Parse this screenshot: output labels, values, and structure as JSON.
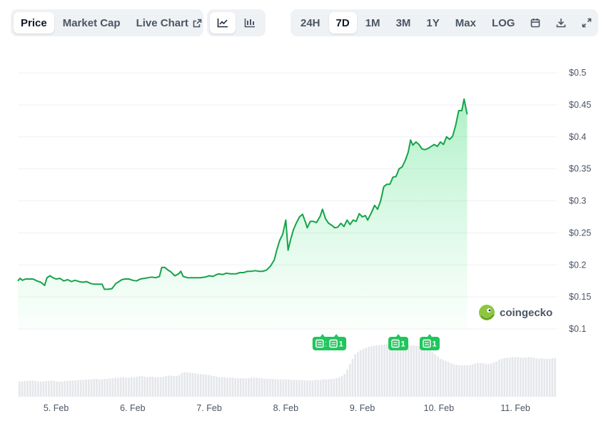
{
  "tabs_left": [
    {
      "label": "Price",
      "active": true
    },
    {
      "label": "Market Cap",
      "active": false
    },
    {
      "label": "Live Chart",
      "active": false,
      "icon": "external-link-icon"
    }
  ],
  "tabs_chart_type": [
    {
      "icon": "line-chart-icon",
      "active": true
    },
    {
      "icon": "candlestick-chart-icon",
      "active": false
    }
  ],
  "tabs_range": [
    {
      "label": "24H",
      "active": false
    },
    {
      "label": "7D",
      "active": true
    },
    {
      "label": "1M",
      "active": false
    },
    {
      "label": "3M",
      "active": false
    },
    {
      "label": "1Y",
      "active": false
    },
    {
      "label": "Max",
      "active": false
    },
    {
      "label": "LOG",
      "active": false
    }
  ],
  "tools": [
    {
      "icon": "calendar-icon"
    },
    {
      "icon": "download-icon"
    },
    {
      "icon": "fullscreen-icon"
    }
  ],
  "watermark": {
    "text": "coingecko"
  },
  "colors": {
    "line": "#16a34a",
    "badge": "#22c55e",
    "volume": "#e5e7eb",
    "accent_fill": "#bbf7d0"
  },
  "chart_data": {
    "type": "area",
    "y_axis": {
      "ticks": [
        "$0.5",
        "$0.45",
        "$0.4",
        "$0.35",
        "$0.3",
        "$0.25",
        "$0.2",
        "$0.15",
        "$0.1"
      ],
      "values": [
        0.5,
        0.45,
        0.4,
        0.35,
        0.3,
        0.25,
        0.2,
        0.15,
        0.1
      ],
      "ylim": [
        0.1,
        0.5
      ]
    },
    "x_axis": {
      "ticks": [
        "5. Feb",
        "6. Feb",
        "7. Feb",
        "8. Feb",
        "9. Feb",
        "10. Feb",
        "11. Feb"
      ],
      "positions": [
        1,
        2,
        3,
        4,
        5,
        6,
        7
      ],
      "xlim": [
        0.5,
        7.54
      ]
    },
    "price_series": [
      [
        0.5,
        0.175
      ],
      [
        0.53,
        0.179
      ],
      [
        0.56,
        0.176
      ],
      [
        0.6,
        0.178
      ],
      [
        0.65,
        0.178
      ],
      [
        0.7,
        0.178
      ],
      [
        0.75,
        0.175
      ],
      [
        0.8,
        0.173
      ],
      [
        0.85,
        0.168
      ],
      [
        0.88,
        0.18
      ],
      [
        0.92,
        0.183
      ],
      [
        0.96,
        0.18
      ],
      [
        1.0,
        0.178
      ],
      [
        1.05,
        0.179
      ],
      [
        1.1,
        0.175
      ],
      [
        1.15,
        0.177
      ],
      [
        1.2,
        0.174
      ],
      [
        1.25,
        0.176
      ],
      [
        1.3,
        0.174
      ],
      [
        1.35,
        0.173
      ],
      [
        1.4,
        0.174
      ],
      [
        1.45,
        0.171
      ],
      [
        1.5,
        0.17
      ],
      [
        1.55,
        0.17
      ],
      [
        1.6,
        0.17
      ],
      [
        1.63,
        0.162
      ],
      [
        1.68,
        0.162
      ],
      [
        1.73,
        0.163
      ],
      [
        1.78,
        0.171
      ],
      [
        1.82,
        0.174
      ],
      [
        1.86,
        0.177
      ],
      [
        1.9,
        0.178
      ],
      [
        1.95,
        0.178
      ],
      [
        2.0,
        0.176
      ],
      [
        2.05,
        0.175
      ],
      [
        2.1,
        0.178
      ],
      [
        2.15,
        0.179
      ],
      [
        2.2,
        0.18
      ],
      [
        2.25,
        0.181
      ],
      [
        2.3,
        0.18
      ],
      [
        2.35,
        0.182
      ],
      [
        2.38,
        0.196
      ],
      [
        2.42,
        0.196
      ],
      [
        2.46,
        0.192
      ],
      [
        2.5,
        0.189
      ],
      [
        2.55,
        0.183
      ],
      [
        2.6,
        0.186
      ],
      [
        2.63,
        0.19
      ],
      [
        2.66,
        0.182
      ],
      [
        2.72,
        0.18
      ],
      [
        2.8,
        0.18
      ],
      [
        2.88,
        0.18
      ],
      [
        2.95,
        0.181
      ],
      [
        3.0,
        0.183
      ],
      [
        3.05,
        0.182
      ],
      [
        3.08,
        0.184
      ],
      [
        3.12,
        0.186
      ],
      [
        3.18,
        0.185
      ],
      [
        3.22,
        0.187
      ],
      [
        3.28,
        0.186
      ],
      [
        3.35,
        0.186
      ],
      [
        3.4,
        0.188
      ],
      [
        3.45,
        0.188
      ],
      [
        3.5,
        0.19
      ],
      [
        3.55,
        0.19
      ],
      [
        3.6,
        0.191
      ],
      [
        3.65,
        0.19
      ],
      [
        3.7,
        0.19
      ],
      [
        3.75,
        0.192
      ],
      [
        3.8,
        0.198
      ],
      [
        3.85,
        0.208
      ],
      [
        3.88,
        0.222
      ],
      [
        3.92,
        0.238
      ],
      [
        3.96,
        0.248
      ],
      [
        4.0,
        0.27
      ],
      [
        4.03,
        0.223
      ],
      [
        4.06,
        0.238
      ],
      [
        4.1,
        0.255
      ],
      [
        4.14,
        0.266
      ],
      [
        4.18,
        0.275
      ],
      [
        4.22,
        0.279
      ],
      [
        4.26,
        0.266
      ],
      [
        4.28,
        0.258
      ],
      [
        4.32,
        0.268
      ],
      [
        4.36,
        0.268
      ],
      [
        4.4,
        0.266
      ],
      [
        4.45,
        0.276
      ],
      [
        4.48,
        0.287
      ],
      [
        4.52,
        0.272
      ],
      [
        4.56,
        0.265
      ],
      [
        4.6,
        0.262
      ],
      [
        4.64,
        0.258
      ],
      [
        4.68,
        0.259
      ],
      [
        4.72,
        0.265
      ],
      [
        4.76,
        0.26
      ],
      [
        4.8,
        0.27
      ],
      [
        4.84,
        0.263
      ],
      [
        4.88,
        0.27
      ],
      [
        4.92,
        0.268
      ],
      [
        4.96,
        0.28
      ],
      [
        5.0,
        0.275
      ],
      [
        5.04,
        0.277
      ],
      [
        5.07,
        0.27
      ],
      [
        5.12,
        0.282
      ],
      [
        5.16,
        0.293
      ],
      [
        5.2,
        0.287
      ],
      [
        5.24,
        0.3
      ],
      [
        5.28,
        0.322
      ],
      [
        5.32,
        0.326
      ],
      [
        5.36,
        0.326
      ],
      [
        5.4,
        0.337
      ],
      [
        5.44,
        0.338
      ],
      [
        5.48,
        0.35
      ],
      [
        5.52,
        0.353
      ],
      [
        5.56,
        0.363
      ],
      [
        5.6,
        0.376
      ],
      [
        5.63,
        0.395
      ],
      [
        5.66,
        0.387
      ],
      [
        5.7,
        0.392
      ],
      [
        5.74,
        0.388
      ],
      [
        5.78,
        0.381
      ],
      [
        5.82,
        0.38
      ],
      [
        5.86,
        0.382
      ],
      [
        5.9,
        0.385
      ],
      [
        5.94,
        0.388
      ],
      [
        5.98,
        0.385
      ],
      [
        6.02,
        0.392
      ],
      [
        6.06,
        0.388
      ],
      [
        6.1,
        0.4
      ],
      [
        6.14,
        0.396
      ],
      [
        6.18,
        0.401
      ],
      [
        6.22,
        0.418
      ],
      [
        6.26,
        0.441
      ],
      [
        6.3,
        0.441
      ],
      [
        6.33,
        0.459
      ],
      [
        6.37,
        0.435
      ]
    ],
    "volume_series": [
      0.28,
      0.28,
      0.29,
      0.29,
      0.3,
      0.3,
      0.29,
      0.28,
      0.28,
      0.28,
      0.29,
      0.29,
      0.3,
      0.29,
      0.28,
      0.28,
      0.28,
      0.29,
      0.29,
      0.3,
      0.3,
      0.3,
      0.31,
      0.31,
      0.31,
      0.32,
      0.32,
      0.32,
      0.33,
      0.33,
      0.32,
      0.32,
      0.33,
      0.33,
      0.34,
      0.34,
      0.35,
      0.35,
      0.36,
      0.36,
      0.35,
      0.35,
      0.36,
      0.36,
      0.37,
      0.38,
      0.38,
      0.37,
      0.36,
      0.37,
      0.37,
      0.36,
      0.36,
      0.36,
      0.37,
      0.38,
      0.39,
      0.39,
      0.38,
      0.38,
      0.4,
      0.44,
      0.45,
      0.45,
      0.44,
      0.44,
      0.43,
      0.42,
      0.42,
      0.41,
      0.41,
      0.4,
      0.39,
      0.38,
      0.37,
      0.36,
      0.36,
      0.36,
      0.35,
      0.35,
      0.35,
      0.34,
      0.34,
      0.34,
      0.34,
      0.34,
      0.34,
      0.35,
      0.35,
      0.35,
      0.34,
      0.34,
      0.33,
      0.33,
      0.33,
      0.33,
      0.32,
      0.32,
      0.32,
      0.32,
      0.32,
      0.32,
      0.31,
      0.31,
      0.31,
      0.31,
      0.31,
      0.3,
      0.3,
      0.3,
      0.3,
      0.31,
      0.31,
      0.31,
      0.32,
      0.32,
      0.32,
      0.33,
      0.33,
      0.34,
      0.36,
      0.38,
      0.42,
      0.5,
      0.6,
      0.7,
      0.78,
      0.82,
      0.86,
      0.88,
      0.9,
      0.92,
      0.93,
      0.94,
      0.95,
      0.95,
      0.96,
      0.96,
      0.97,
      0.97,
      0.97,
      0.97,
      0.97,
      0.96,
      0.96,
      0.96,
      0.95,
      0.95,
      0.95,
      0.94,
      0.94,
      0.93,
      0.92,
      0.9,
      0.86,
      0.82,
      0.78,
      0.74,
      0.7,
      0.68,
      0.66,
      0.64,
      0.62,
      0.6,
      0.59,
      0.58,
      0.58,
      0.58,
      0.58,
      0.58,
      0.6,
      0.61,
      0.62,
      0.62,
      0.62,
      0.61,
      0.6,
      0.61,
      0.63,
      0.65,
      0.68,
      0.7,
      0.71,
      0.72,
      0.72,
      0.73,
      0.73,
      0.73,
      0.72,
      0.72,
      0.72,
      0.73,
      0.73,
      0.72,
      0.71,
      0.7,
      0.71,
      0.7,
      0.7,
      0.7,
      0.71,
      0.71
    ],
    "news_badges": [
      {
        "x": 4.48,
        "label": "1"
      },
      {
        "x": 4.66,
        "label": "1"
      },
      {
        "x": 5.47,
        "label": "1"
      },
      {
        "x": 5.88,
        "label": "1"
      }
    ],
    "grid": true,
    "legend": "none"
  }
}
